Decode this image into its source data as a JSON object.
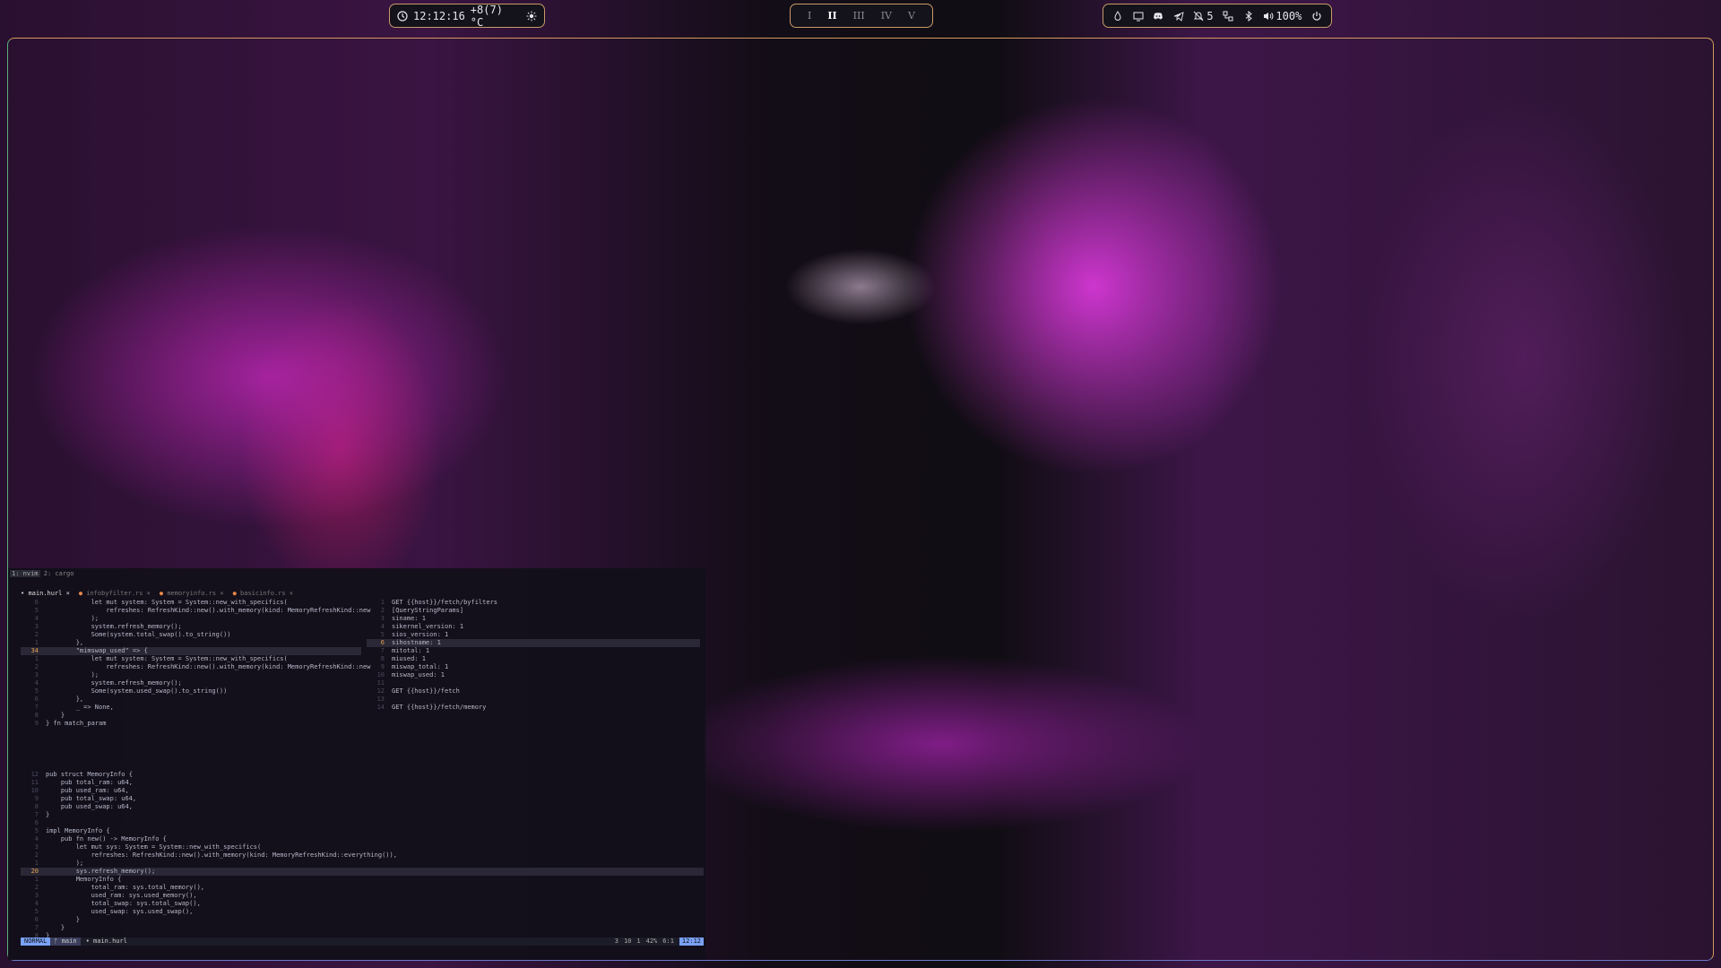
{
  "bar": {
    "clock": "12:12:16",
    "weather": "+8(7) °C",
    "workspaces": [
      "I",
      "II",
      "III",
      "IV",
      "V"
    ],
    "active_workspace": "II",
    "notifications": "5",
    "volume": "100%"
  },
  "tmux": {
    "window1": "1: nvim",
    "window2": "2: cargo"
  },
  "editor": {
    "tabs": [
      {
        "label": "main.hurl",
        "current": true
      },
      {
        "label": "infobyfilter.rs",
        "current": false
      },
      {
        "label": "memoryinfo.rs",
        "current": false
      },
      {
        "label": "basicinfo.rs",
        "current": false
      }
    ],
    "left_pane": [
      {
        "n": "6",
        "t": "            let mut system: System = System::new_with_specifics("
      },
      {
        "n": "5",
        "t": "                refreshes: RefreshKind::new().with_memory(kind: MemoryRefreshKind::new"
      },
      {
        "n": "4",
        "t": "            );"
      },
      {
        "n": "3",
        "t": "            system.refresh_memory();"
      },
      {
        "n": "2",
        "t": "            Some(system.total_swap().to_string())"
      },
      {
        "n": "1",
        "t": "        },"
      },
      {
        "n": "34",
        "t": "        \"mimswap_used\" => {",
        "cur": true
      },
      {
        "n": "1",
        "t": "            let mut system: System = System::new_with_specifics("
      },
      {
        "n": "2",
        "t": "                refreshes: RefreshKind::new().with_memory(kind: MemoryRefreshKind::new"
      },
      {
        "n": "3",
        "t": "            );"
      },
      {
        "n": "4",
        "t": "            system.refresh_memory();"
      },
      {
        "n": "5",
        "t": "            Some(system.used_swap().to_string())"
      },
      {
        "n": "6",
        "t": "        },"
      },
      {
        "n": "7",
        "t": "        _ => None,"
      },
      {
        "n": "8",
        "t": "    }"
      },
      {
        "n": "9",
        "t": "} fn match_param"
      }
    ],
    "right_pane": [
      {
        "n": "1",
        "t": "GET {{host}}/fetch/byfilters"
      },
      {
        "n": "2",
        "t": "[QueryStringParams]"
      },
      {
        "n": "3",
        "t": "siname: 1"
      },
      {
        "n": "4",
        "t": "sikernel_version: 1"
      },
      {
        "n": "5",
        "t": "sios_version: 1"
      },
      {
        "n": "6",
        "t": "sihostname: 1",
        "cur": true
      },
      {
        "n": "7",
        "t": "mitotal: 1"
      },
      {
        "n": "8",
        "t": "miused: 1"
      },
      {
        "n": "9",
        "t": "miswap_total: 1"
      },
      {
        "n": "10",
        "t": "miswap_used: 1"
      },
      {
        "n": "11",
        "t": ""
      },
      {
        "n": "12",
        "t": "GET {{host}}/fetch"
      },
      {
        "n": "13",
        "t": ""
      },
      {
        "n": "14",
        "t": "GET {{host}}/fetch/memory"
      }
    ],
    "bottom_pane": [
      {
        "n": "12",
        "t": "pub struct MemoryInfo {"
      },
      {
        "n": "11",
        "t": "    pub total_ram: u64,"
      },
      {
        "n": "10",
        "t": "    pub used_ram: u64,"
      },
      {
        "n": "9",
        "t": "    pub total_swap: u64,"
      },
      {
        "n": "8",
        "t": "    pub used_swap: u64,"
      },
      {
        "n": "7",
        "t": "}"
      },
      {
        "n": "6",
        "t": ""
      },
      {
        "n": "5",
        "t": "impl MemoryInfo {"
      },
      {
        "n": "4",
        "t": "    pub fn new() -> MemoryInfo {"
      },
      {
        "n": "3",
        "t": "        let mut sys: System = System::new_with_specifics("
      },
      {
        "n": "2",
        "t": "            refreshes: RefreshKind::new().with_memory(kind: MemoryRefreshKind::everything()),"
      },
      {
        "n": "1",
        "t": "        );"
      },
      {
        "n": "20",
        "t": "        sys.refresh_memory();",
        "cur": true
      },
      {
        "n": "1",
        "t": "        MemoryInfo {"
      },
      {
        "n": "2",
        "t": "            total_ram: sys.total_memory(),"
      },
      {
        "n": "3",
        "t": "            used_ram: sys.used_memory(),"
      },
      {
        "n": "4",
        "t": "            total_swap: sys.total_swap(),"
      },
      {
        "n": "5",
        "t": "            used_swap: sys.used_swap(),"
      },
      {
        "n": "6",
        "t": "        }"
      },
      {
        "n": "7",
        "t": "    }"
      },
      {
        "n": "8",
        "t": "}"
      }
    ],
    "statusline": {
      "mode": "NORMAL",
      "branch": "main",
      "file": "main.hurl",
      "diag": "3",
      "diag2": "10",
      "diag3": "1",
      "percent": "42%",
      "position": "6:1",
      "time": "12:12"
    }
  }
}
